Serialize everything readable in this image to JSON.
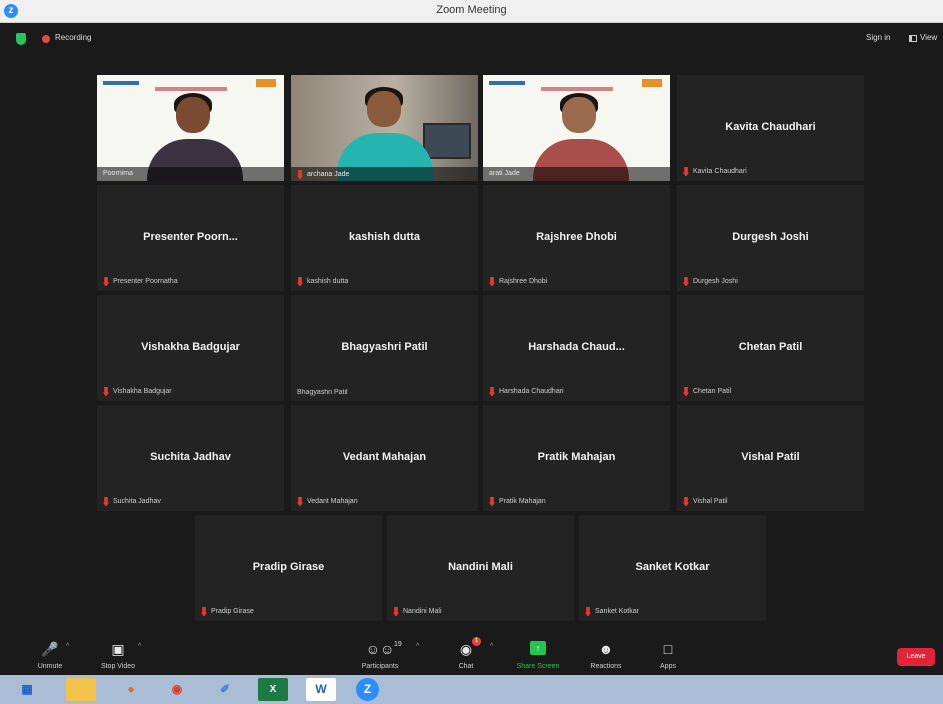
{
  "window": {
    "title": "Zoom Meeting"
  },
  "topbar": {
    "recording_label": "Recording",
    "sign_in": "Sign in",
    "view_label": "View"
  },
  "video_tiles": [
    {
      "name": "Poornima"
    },
    {
      "name": "archana Jade"
    },
    {
      "name": "arati Jade"
    }
  ],
  "participant_tiles": [
    {
      "display": "Kavita Chaudhari",
      "label": "Kavita Chaudhari",
      "muted": true
    },
    {
      "display": "Presenter Poorn...",
      "label": "Presenter Poornatha",
      "muted": true
    },
    {
      "display": "kashish dutta",
      "label": "kashish dutta",
      "muted": true
    },
    {
      "display": "Rajshree Dhobi",
      "label": "Rajshree Dhobi",
      "muted": true
    },
    {
      "display": "Durgesh Joshi",
      "label": "Durgesh Joshi",
      "muted": true
    },
    {
      "display": "Vishakha Badgujar",
      "label": "Vishakha Badgujar",
      "muted": true
    },
    {
      "display": "Bhagyashri Patil",
      "label": "Bhagyashri Patil",
      "muted": false
    },
    {
      "display": "Harshada Chaud...",
      "label": "Harshada Chaudhari",
      "muted": true
    },
    {
      "display": "Chetan Patil",
      "label": "Chetan Patil",
      "muted": true
    },
    {
      "display": "Suchita Jadhav",
      "label": "Suchita Jadhav",
      "muted": true
    },
    {
      "display": "Vedant Mahajan",
      "label": "Vedant Mahajan",
      "muted": true
    },
    {
      "display": "Pratik Mahajan",
      "label": "Pratik Mahajan",
      "muted": true
    },
    {
      "display": "Vishal Patil",
      "label": "Vishal Patil",
      "muted": true
    },
    {
      "display": "Pradip Girase",
      "label": "Pradip Girase",
      "muted": true
    },
    {
      "display": "Nandini Mali",
      "label": "Nandini Mali",
      "muted": true
    },
    {
      "display": "Sanket Kotkar",
      "label": "Sanket Kotkar",
      "muted": true
    }
  ],
  "toolbar": {
    "unmute": "Unmute",
    "stop_video": "Stop Video",
    "participants": "Participants",
    "participants_count": "19",
    "chat": "Chat",
    "chat_badge": "1",
    "share_screen": "Share Screen",
    "reactions": "Reactions",
    "apps": "Apps",
    "leave": "Leave"
  },
  "colors": {
    "active_speaker": "#9be564",
    "share_green": "#23c552",
    "leave_red": "#e0243a",
    "muted_red": "#e8382c"
  }
}
